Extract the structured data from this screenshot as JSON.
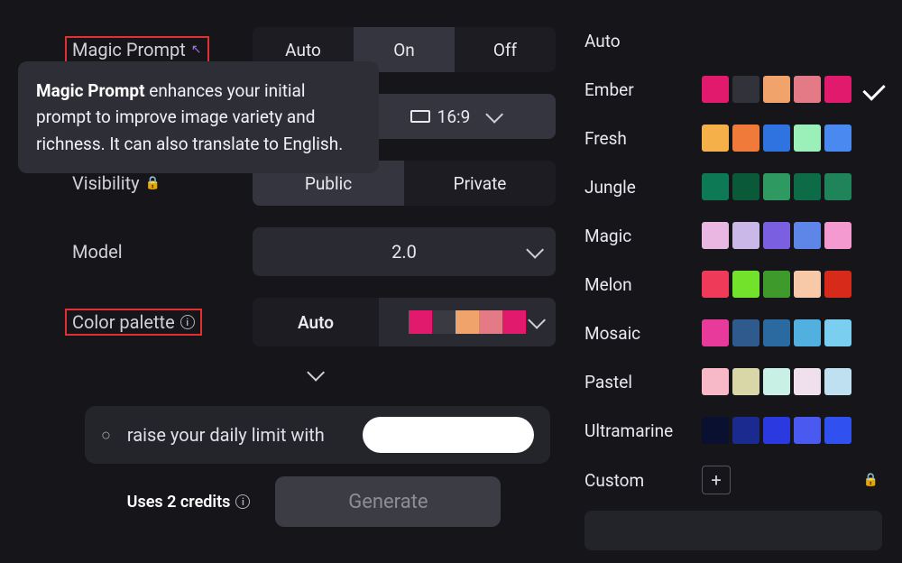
{
  "magic_prompt": {
    "label": "Magic Prompt",
    "seg": {
      "auto": "Auto",
      "on": "On",
      "off": "Off",
      "selected": "On"
    },
    "tooltip_lead": "Magic Prompt",
    "tooltip_rest": " enhances your initial prompt to improve image variety and richness. It can also translate to English."
  },
  "aspect_ratio": {
    "value": "16:9"
  },
  "visibility": {
    "label": "Visibility",
    "public": "Public",
    "private": "Private",
    "selected": "Public"
  },
  "model": {
    "label": "Model",
    "value": "2.0"
  },
  "color_palette": {
    "label": "Color palette",
    "auto": "Auto",
    "swatches": [
      "#e21a6d",
      "#3a3a42",
      "#f0a46b",
      "#e47a86",
      "#e21a6d"
    ]
  },
  "promo": {
    "text": "raise your daily limit with"
  },
  "footer": {
    "credits": "Uses 2 credits",
    "generate": "Generate"
  },
  "palettes": {
    "selected": "Ember",
    "list": [
      {
        "name": "Auto",
        "colors": []
      },
      {
        "name": "Ember",
        "colors": [
          "#e21a6d",
          "#32323a",
          "#f0a46b",
          "#e47a86",
          "#e21a6d"
        ]
      },
      {
        "name": "Fresh",
        "colors": [
          "#f6b04a",
          "#f07a3a",
          "#2f73e0",
          "#9af0b8",
          "#4a8af0"
        ]
      },
      {
        "name": "Jungle",
        "colors": [
          "#0d7a55",
          "#0a5a3a",
          "#2e9a62",
          "#0e6b47",
          "#1f845a"
        ]
      },
      {
        "name": "Magic",
        "colors": [
          "#e9b7e2",
          "#c9b8e8",
          "#7a5fe0",
          "#5e86e8",
          "#f59ad0"
        ]
      },
      {
        "name": "Melon",
        "colors": [
          "#ef3a5a",
          "#72e22a",
          "#3e9a2a",
          "#f8c9a8",
          "#d82a1a"
        ]
      },
      {
        "name": "Mosaic",
        "colors": [
          "#e83a9a",
          "#2f5a8e",
          "#2a6aa0",
          "#52b0e0",
          "#7acff0"
        ]
      },
      {
        "name": "Pastel",
        "colors": [
          "#f7b9c8",
          "#d9d7a8",
          "#c8f0e4",
          "#f0e0ee",
          "#bfe0f0"
        ]
      },
      {
        "name": "Ultramarine",
        "colors": [
          "#0a1030",
          "#1a2a8e",
          "#2a3ae0",
          "#4a5af0",
          "#3050f0"
        ]
      }
    ],
    "custom": "Custom"
  }
}
